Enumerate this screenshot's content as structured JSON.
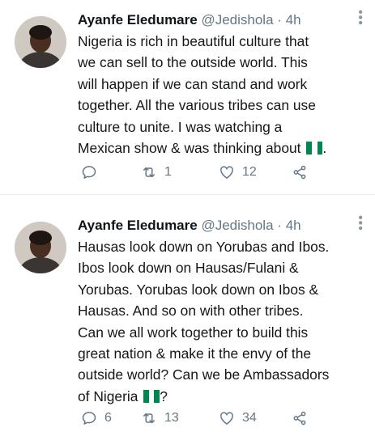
{
  "tweets": [
    {
      "author_name": "Ayanfe Eledumare",
      "handle": "@Jedishola",
      "separator": "·",
      "time": "4h",
      "text": "Nigeria is rich in beautiful culture that\nwe can sell to the outside world. This\nwill happen if we can stand and work\ntogether. All the various tribes can use\nculture to unite. I was watching a\nMexican show & was thinking about",
      "text_suffix": ".",
      "flag_emoji": "nigeria-flag",
      "replies": "",
      "retweets": "1",
      "likes": "12"
    },
    {
      "author_name": "Ayanfe Eledumare",
      "handle": "@Jedishola",
      "separator": "·",
      "time": "4h",
      "text": "Hausas look down on Yorubas and Ibos.\nIbos look down on Hausas/Fulani &\nYorubas. Yorubas look down on Ibos &\nHausas. And so on with other tribes.\nCan we all work together to build this\ngreat nation & make it the envy of the\noutside world? Can we be Ambassadors\nof Nigeria",
      "text_suffix": "?",
      "flag_emoji": "nigeria-flag",
      "replies": "6",
      "retweets": "13",
      "likes": "34"
    }
  ],
  "colors": {
    "text": "#14171a",
    "secondary": "#657786",
    "divider": "#e6ecf0",
    "flag_green": "#008751",
    "flag_white": "#ffffff"
  },
  "icons": [
    "reply-icon",
    "retweet-icon",
    "like-icon",
    "share-icon",
    "more-options-icon"
  ]
}
